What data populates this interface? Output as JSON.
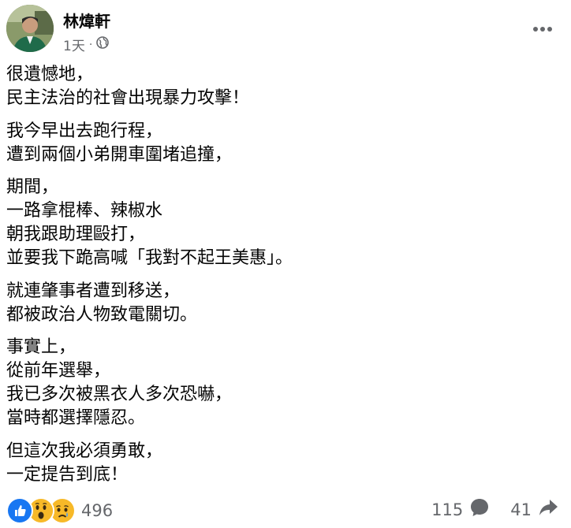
{
  "post": {
    "author": "林煒軒",
    "time": "1天",
    "separator": "·",
    "privacy_icon": "globe-icon",
    "more_icon": "more-horizontal-icon"
  },
  "content": {
    "paragraphs": [
      [
        "很遺憾地，",
        "民主法治的社會出現暴力攻擊！"
      ],
      [
        "我今早出去跑行程，",
        "遭到兩個小弟開車圍堵追撞，"
      ],
      [
        "期間，",
        "一路拿棍棒、辣椒水",
        "朝我跟助理毆打，",
        "並要我下跪高喊「我對不起王美惠」。"
      ],
      [
        "就連肇事者遭到移送，",
        "都被政治人物致電關切。"
      ],
      [
        "事實上，",
        "從前年選舉，",
        "我已多次被黑衣人多次恐嚇，",
        "當時都選擇隱忍。"
      ],
      [
        "但這次我必須勇敢，",
        "一定提告到底！"
      ]
    ]
  },
  "footer": {
    "reaction_icons": [
      "like-icon",
      "wow-icon",
      "sad-icon"
    ],
    "reaction_count": "496",
    "comments_count": "115",
    "shares_count": "41"
  },
  "colors": {
    "text": "#050505",
    "secondary_text": "#65676b",
    "like_blue": "#1877f2",
    "reaction_yellow": "#f7b928"
  }
}
